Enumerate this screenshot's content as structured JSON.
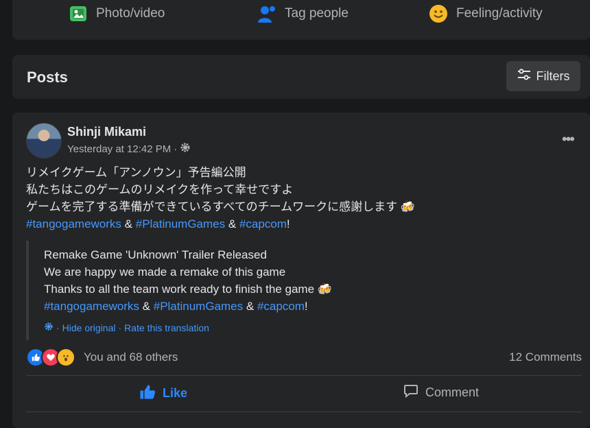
{
  "composer": {
    "photo_label": "Photo/video",
    "tag_label": "Tag people",
    "feeling_label": "Feeling/activity"
  },
  "posts_header": {
    "title": "Posts",
    "filters_label": "Filters"
  },
  "post": {
    "author": "Shinji Mikami",
    "timestamp": "Yesterday at 12:42 PM",
    "separator": "·",
    "more": "•••",
    "original_lines": [
      "リメイクゲーム「アンノウン」予告編公開",
      "私たちはこのゲームのリメイクを作って幸せですよ",
      "ゲームを完了する準備ができているすべてのチームワークに感謝します"
    ],
    "hashtags": {
      "tag1": "#tangogameworks",
      "amp": "&",
      "tag2": "#PlatinumGames",
      "tag3": "#capcom",
      "end": "!"
    },
    "translation_lines": [
      "Remake Game 'Unknown' Trailer Released",
      "We are happy we made a remake of this game",
      "Thanks to all the team work ready to finish the game"
    ],
    "translation_links": {
      "hide": "Hide original",
      "rate": "Rate this translation",
      "dot": "·"
    },
    "reactions_text": "You and 68 others",
    "comments_text": "12 Comments",
    "like_label": "Like",
    "comment_label": "Comment"
  },
  "colors": {
    "background": "#18191a",
    "card": "#242526",
    "link": "#4599ff",
    "like_active": "#2d88ff"
  }
}
